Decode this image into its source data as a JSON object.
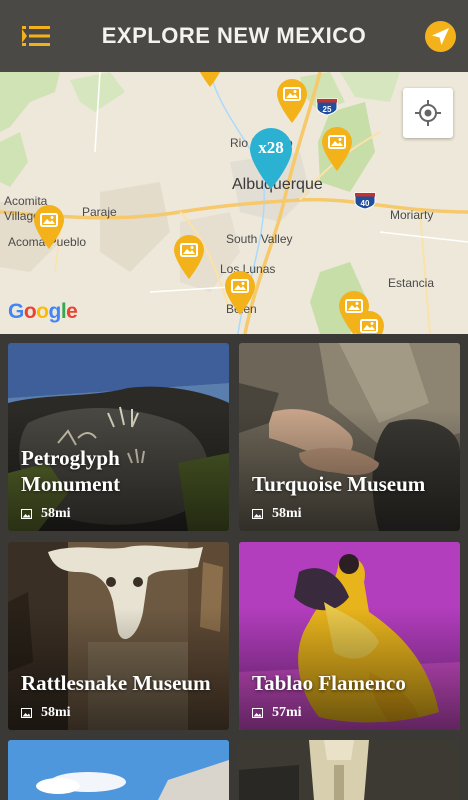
{
  "header": {
    "title": "EXPLORE NEW MEXICO",
    "menu_icon": "menu-icon",
    "locate_icon": "navigation-arrow-icon",
    "accent": "#f3b21a",
    "background": "#4a4945"
  },
  "map": {
    "labels": {
      "rio_rancho": "Rio Rancho",
      "albuquerque": "Albuquerque",
      "acomita": "Acomita",
      "village": "Village",
      "paraje": "Paraje",
      "acoma_pueblo": "Acoma Pueblo",
      "south_valley": "South Valley",
      "los_lunas": "Los Lunas",
      "belen": "Belen",
      "moriarty": "Moriarty",
      "estancia": "Estancia"
    },
    "highways": {
      "i25": "25",
      "i40": "40"
    },
    "cluster_label": "x28",
    "cluster_color": "#2bb1d1",
    "pin_color": "#f3b21a",
    "google_logo": "Google",
    "gps_icon": "crosshair-icon"
  },
  "cards": [
    {
      "title": "Petroglyph Monument",
      "distance": "58mi",
      "icon": "image-icon"
    },
    {
      "title": "Turquoise Museum",
      "distance": "58mi",
      "icon": "image-icon"
    },
    {
      "title": "Rattlesnake Museum",
      "distance": "58mi",
      "icon": "image-icon"
    },
    {
      "title": "Tablao Flamenco",
      "distance": "57mi",
      "icon": "image-icon"
    },
    {
      "title": "",
      "distance": "",
      "icon": ""
    },
    {
      "title": "",
      "distance": "",
      "icon": ""
    }
  ]
}
